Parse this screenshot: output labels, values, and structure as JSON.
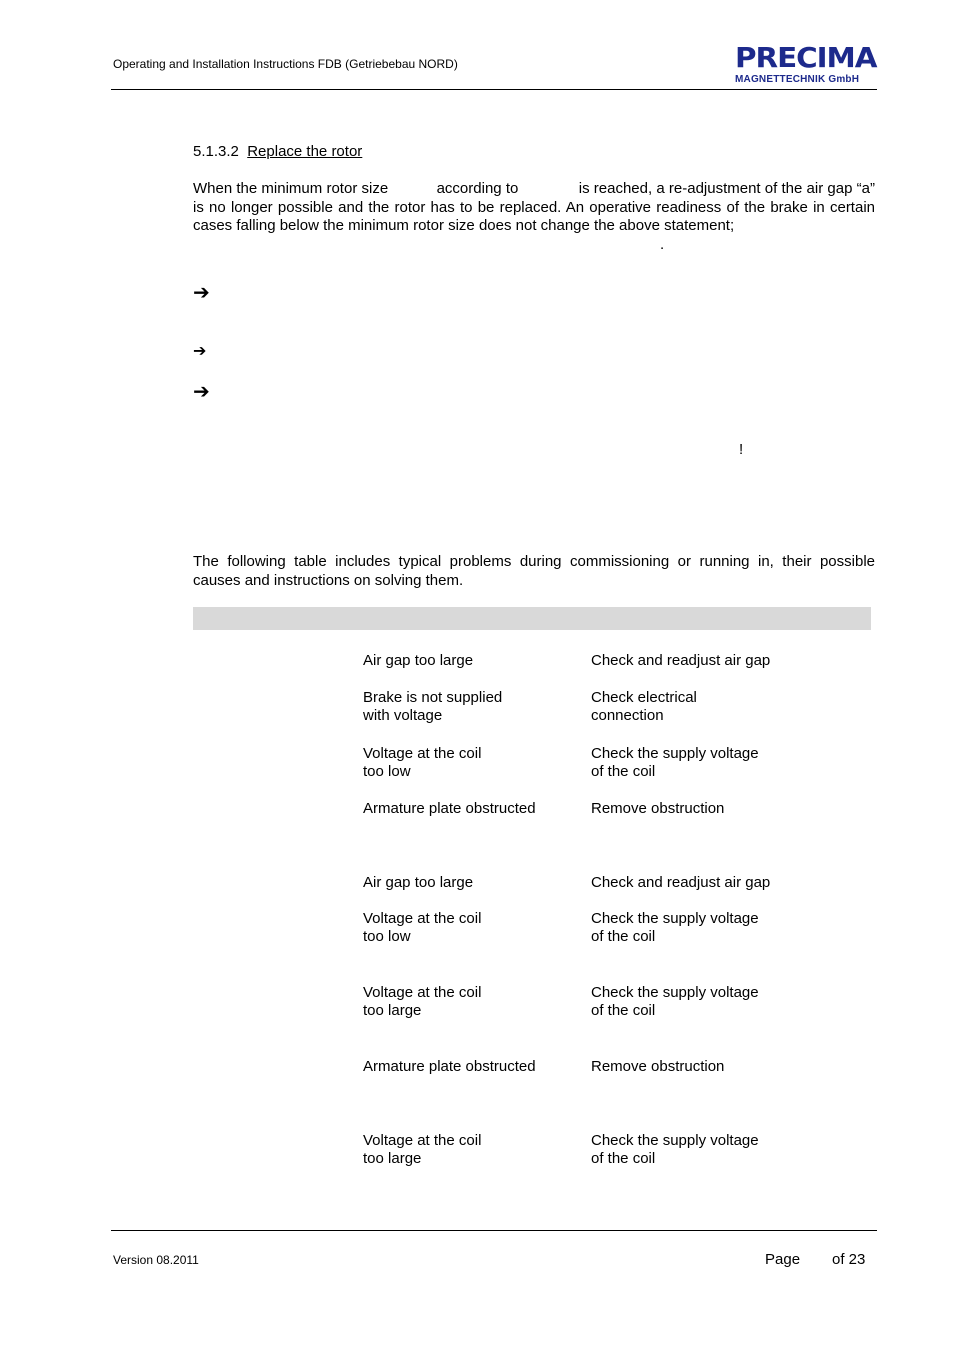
{
  "header": {
    "title": "Operating and Installation Instructions FDB (Getriebebau NORD)",
    "logo_main": "PRECIMA",
    "logo_sub": "MAGNETTECHNIK GmbH"
  },
  "section": {
    "number": "5.1.3.2",
    "title": "Replace the rotor"
  },
  "paragraph1": {
    "part1": "When the minimum rotor size",
    "part2": "according to",
    "part3": "is reached, a re-adjustment of the air gap “a” is no longer possible and the rotor has to be replaced. An operative readiness of the brake in certain cases falling below the minimum rotor size does not change the above statement;",
    "end": "."
  },
  "bullets": [
    "➔",
    "➔",
    "➔"
  ],
  "exclamation": "!",
  "paragraph2": "The following table includes typical problems during commissioning or running in, their possible causes and instructions on solving them.",
  "table": {
    "rows": [
      {
        "cause": [
          "Air gap too large"
        ],
        "remedy": [
          "Check and readjust air gap"
        ]
      },
      {
        "cause": [
          "Brake is not supplied",
          "with voltage"
        ],
        "remedy": [
          "Check electrical",
          "connection"
        ]
      },
      {
        "cause": [
          "Voltage at the coil",
          "too low"
        ],
        "remedy": [
          "Check the supply voltage",
          "of the coil"
        ]
      },
      {
        "cause": [
          "Armature plate obstructed"
        ],
        "remedy": [
          "Remove obstruction"
        ]
      },
      {
        "cause": [
          "Air gap too large"
        ],
        "remedy": [
          "Check and readjust air gap"
        ]
      },
      {
        "cause": [
          "Voltage at the coil",
          "too low"
        ],
        "remedy": [
          "Check the supply voltage",
          "of the coil"
        ]
      },
      {
        "cause": [
          "Voltage at the coil",
          "too large"
        ],
        "remedy": [
          "Check the supply voltage",
          "of the coil"
        ]
      },
      {
        "cause": [
          "Armature plate obstructed"
        ],
        "remedy": [
          "Remove obstruction"
        ]
      },
      {
        "cause": [
          "Voltage at the coil",
          "too large"
        ],
        "remedy": [
          "Check the supply voltage",
          "of the coil"
        ]
      }
    ]
  },
  "footer": {
    "version": "Version 08.2011",
    "page_label": "Page",
    "of_label": "of 23"
  }
}
